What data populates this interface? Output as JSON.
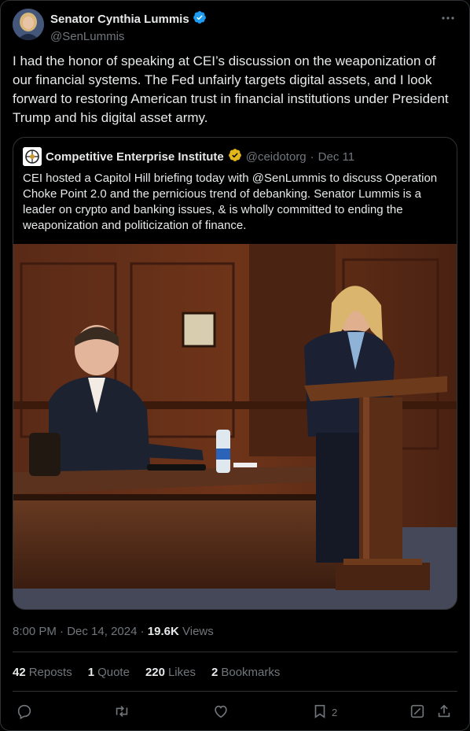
{
  "author": {
    "display_name": "Senator Cynthia Lummis",
    "handle": "@SenLummis"
  },
  "tweet": {
    "text": "I had the honor of speaking at CEI’s discussion on the weaponization of our financial systems. The Fed unfairly targets digital assets, and I look forward to restoring American trust in financial institutions under President Trump and his digital asset army."
  },
  "quoted": {
    "display_name": "Competitive Enterprise Institute",
    "handle": "@ceidotorg",
    "separator": " · ",
    "date": "Dec 11",
    "text": "CEI hosted a Capitol Hill briefing today with @SenLummis to discuss Operation Choke Point 2.0 and the pernicious trend of debanking. Senator Lummis is a leader on crypto and banking issues, & is wholly committed to ending the weaponization and politicization of finance."
  },
  "meta": {
    "time": "8:00 PM",
    "date": "Dec 14, 2024",
    "dot": " · ",
    "views_count": "19.6K",
    "views_label": "Views"
  },
  "stats": {
    "reposts_count": "42",
    "reposts_label": "Reposts",
    "quotes_count": "1",
    "quotes_label": "Quote",
    "likes_count": "220",
    "likes_label": "Likes",
    "bookmarks_count": "2",
    "bookmarks_label": "Bookmarks"
  },
  "actions": {
    "bookmark_count": "2"
  },
  "colors": {
    "background": "#000000",
    "text": "#e7e9ea",
    "muted": "#71767b",
    "border": "#2f3336",
    "verified_blue": "#1d9bf0",
    "verified_gold": "#e2b719"
  },
  "icons": [
    "verified-blue-badge",
    "verified-gold-badge",
    "more-icon",
    "reply-icon",
    "repost-icon",
    "like-icon",
    "bookmark-icon",
    "grok-icon",
    "share-icon"
  ]
}
